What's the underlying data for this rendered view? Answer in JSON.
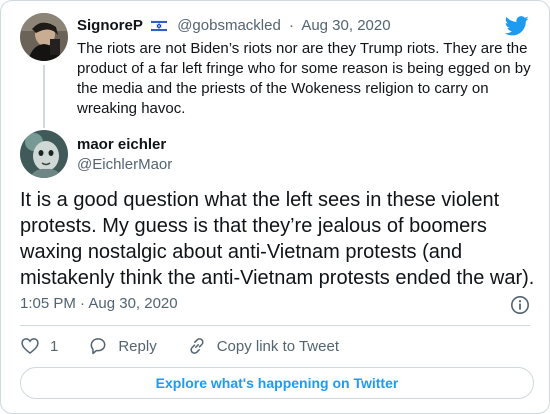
{
  "parent_tweet": {
    "display_name": "SignoreP",
    "handle": "@gobsmackled",
    "separator": "·",
    "date": "Aug 30, 2020",
    "text": "The riots are not Biden’s riots nor are they Trump riots. They are the product of a far left fringe who for some reason is being egged on by the media and the priests of the Wokeness religion to carry on wreaking havoc."
  },
  "main_tweet": {
    "display_name": "maor eichler",
    "handle": "@EichlerMaor",
    "text": "It is a good question what the left sees in these violent protests. My guess is that they’re jealous of boomers waxing nostalgic about anti-Vietnam protests (and mistakenly think the anti-Vietnam protests ended the war).",
    "timestamp": "1:05 PM · Aug 30, 2020"
  },
  "actions": {
    "like_count": "1",
    "reply_label": "Reply",
    "copy_link_label": "Copy link to Tweet"
  },
  "explore_label": "Explore what's happening on Twitter",
  "colors": {
    "accent": "#1d9bf0",
    "text_secondary": "#536471",
    "border": "#cfd9de"
  },
  "icons": {
    "brand": "twitter-bird-icon",
    "flag": "israel-flag-icon",
    "info": "info-icon",
    "like": "heart-icon",
    "reply": "reply-bubble-icon",
    "copy": "link-icon"
  }
}
